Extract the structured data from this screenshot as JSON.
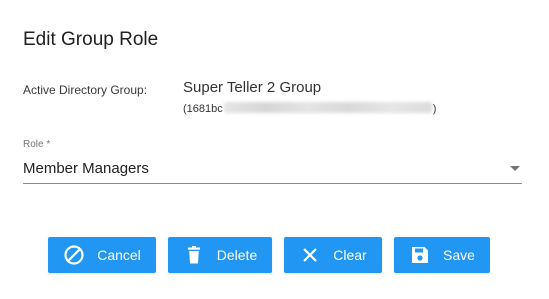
{
  "dialog": {
    "title": "Edit Group Role"
  },
  "ad_group": {
    "label": "Active Directory Group:",
    "name": "Super Teller 2 Group",
    "id_prefix": "(1681bc",
    "id_suffix": ")"
  },
  "role": {
    "label": "Role *",
    "selected": "Member Managers"
  },
  "actions": {
    "cancel_label": "Cancel",
    "delete_label": "Delete",
    "clear_label": "Clear",
    "save_label": "Save"
  },
  "colors": {
    "primary": "#2196f3",
    "text": "#212121",
    "muted": "#757575"
  },
  "icons": {
    "cancel": "block-icon",
    "delete": "trash-icon",
    "clear": "close-icon",
    "save": "floppy-disk-icon",
    "dropdown": "caret-down-icon"
  }
}
